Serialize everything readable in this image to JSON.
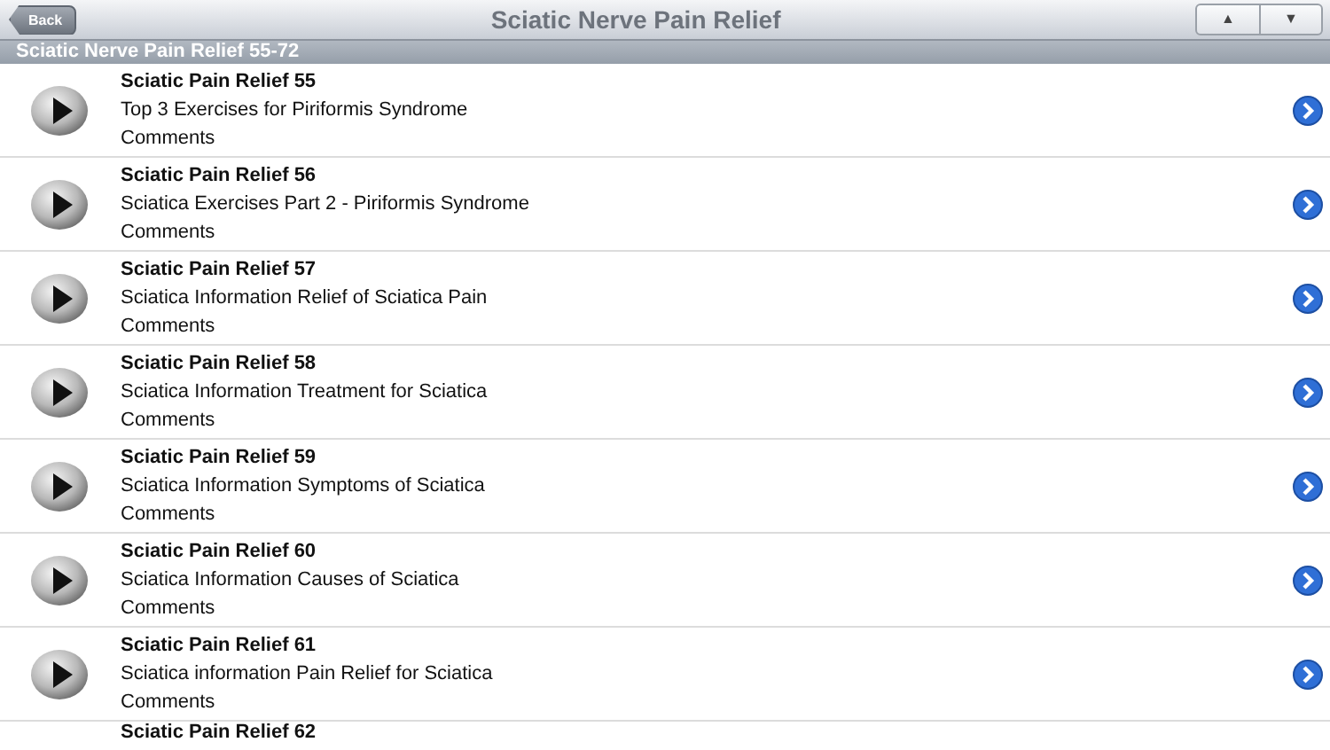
{
  "navbar": {
    "back_label": "Back",
    "title": "Sciatic Nerve Pain Relief",
    "up_label": "▲",
    "down_label": "▼"
  },
  "section_header": "Sciatic Nerve Pain Relief 55-72",
  "items": [
    {
      "title": "Sciatic Pain Relief 55",
      "subtitle": "Top 3 Exercises for Piriformis Syndrome",
      "comments": "Comments"
    },
    {
      "title": "Sciatic Pain Relief 56",
      "subtitle": "Sciatica Exercises Part 2 - Piriformis Syndrome",
      "comments": "Comments"
    },
    {
      "title": "Sciatic Pain Relief 57",
      "subtitle": "Sciatica Information Relief of Sciatica Pain",
      "comments": "Comments"
    },
    {
      "title": "Sciatic Pain Relief 58",
      "subtitle": "Sciatica Information Treatment for Sciatica",
      "comments": "Comments"
    },
    {
      "title": "Sciatic Pain Relief 59",
      "subtitle": "Sciatica Information Symptoms of Sciatica",
      "comments": "Comments"
    },
    {
      "title": "Sciatic Pain Relief 60",
      "subtitle": "Sciatica Information Causes of Sciatica",
      "comments": "Comments"
    },
    {
      "title": "Sciatic Pain Relief 61",
      "subtitle": "Sciatica information Pain Relief for Sciatica",
      "comments": "Comments"
    },
    {
      "title": "Sciatic Pain Relief 62"
    }
  ]
}
